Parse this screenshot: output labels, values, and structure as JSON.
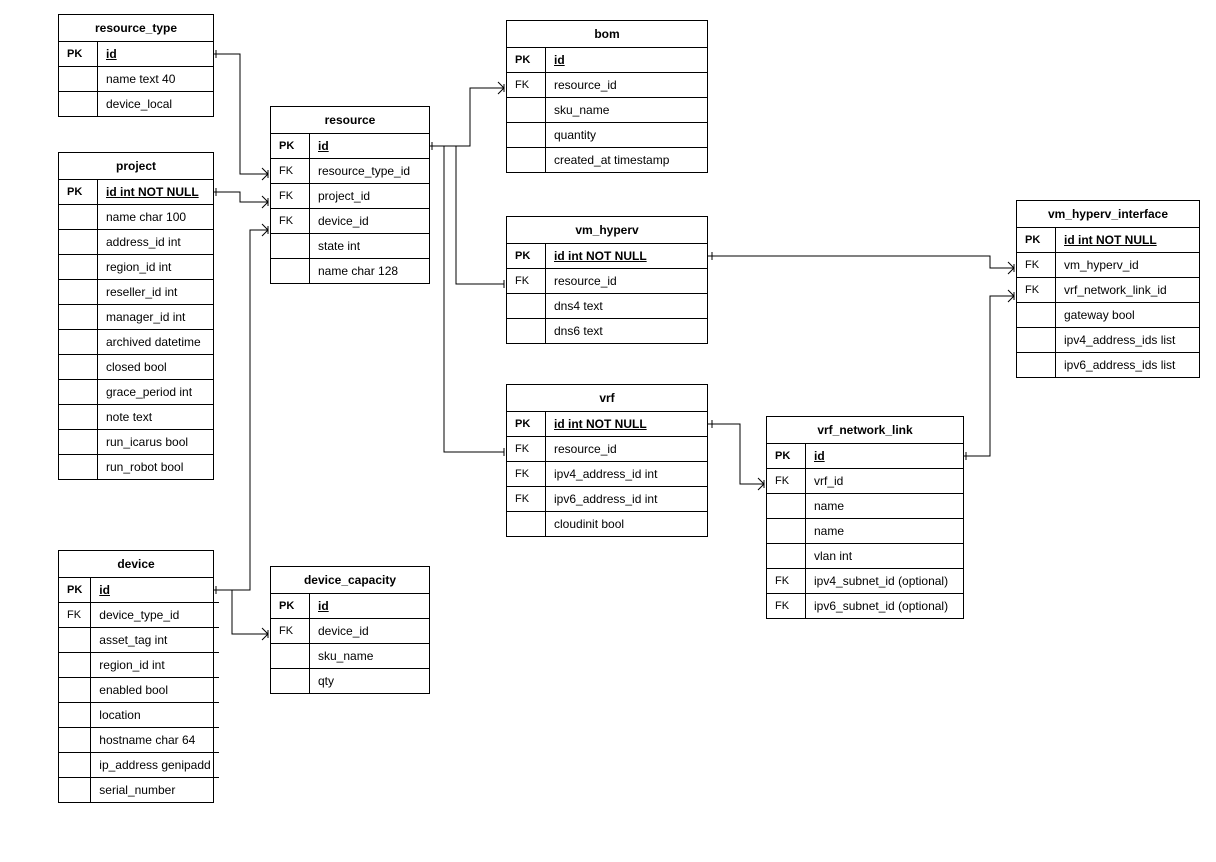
{
  "tables": {
    "resource_type": {
      "title": "resource_type",
      "rows": [
        {
          "key": "PK",
          "field": "id",
          "pk": true
        },
        {
          "key": "",
          "field": "name text 40"
        },
        {
          "key": "",
          "field": "device_local"
        }
      ]
    },
    "project": {
      "title": "project",
      "rows": [
        {
          "key": "PK",
          "field": "id int NOT NULL",
          "pk": true
        },
        {
          "key": "",
          "field": "name char 100"
        },
        {
          "key": "",
          "field": "address_id int"
        },
        {
          "key": "",
          "field": "region_id int"
        },
        {
          "key": "",
          "field": "reseller_id int"
        },
        {
          "key": "",
          "field": "manager_id int"
        },
        {
          "key": "",
          "field": "archived datetime"
        },
        {
          "key": "",
          "field": "closed bool"
        },
        {
          "key": "",
          "field": "grace_period int"
        },
        {
          "key": "",
          "field": "note text"
        },
        {
          "key": "",
          "field": "run_icarus bool"
        },
        {
          "key": "",
          "field": "run_robot bool"
        }
      ]
    },
    "device": {
      "title": "device",
      "rows": [
        {
          "key": "PK",
          "field": "id",
          "pk": true
        },
        {
          "key": "FK",
          "field": "device_type_id",
          "fk": true
        },
        {
          "key": "",
          "field": "asset_tag int"
        },
        {
          "key": "",
          "field": "region_id int"
        },
        {
          "key": "",
          "field": "enabled bool"
        },
        {
          "key": "",
          "field": "location"
        },
        {
          "key": "",
          "field": "hostname char 64"
        },
        {
          "key": "",
          "field": "ip_address genipadd"
        },
        {
          "key": "",
          "field": "serial_number"
        }
      ]
    },
    "resource": {
      "title": "resource",
      "rows": [
        {
          "key": "PK",
          "field": "id",
          "pk": true
        },
        {
          "key": "FK",
          "field": "resource_type_id",
          "fk": true
        },
        {
          "key": "FK",
          "field": "project_id",
          "fk": true
        },
        {
          "key": "FK",
          "field": "device_id",
          "fk": true
        },
        {
          "key": "",
          "field": "state int"
        },
        {
          "key": "",
          "field": "name char 128"
        }
      ]
    },
    "device_capacity": {
      "title": "device_capacity",
      "rows": [
        {
          "key": "PK",
          "field": "id",
          "pk": true
        },
        {
          "key": "FK",
          "field": "device_id",
          "fk": true
        },
        {
          "key": "",
          "field": "sku_name"
        },
        {
          "key": "",
          "field": "qty"
        }
      ]
    },
    "bom": {
      "title": "bom",
      "rows": [
        {
          "key": "PK",
          "field": "id",
          "pk": true
        },
        {
          "key": "FK",
          "field": "resource_id",
          "fk": true
        },
        {
          "key": "",
          "field": "sku_name"
        },
        {
          "key": "",
          "field": "quantity"
        },
        {
          "key": "",
          "field": "created_at timestamp"
        }
      ]
    },
    "vm_hyperv": {
      "title": "vm_hyperv",
      "rows": [
        {
          "key": "PK",
          "field": "id int NOT NULL",
          "pk": true
        },
        {
          "key": "FK",
          "field": "resource_id",
          "fk": true
        },
        {
          "key": "",
          "field": "dns4 text"
        },
        {
          "key": "",
          "field": "dns6 text"
        }
      ]
    },
    "vrf": {
      "title": "vrf",
      "rows": [
        {
          "key": "PK",
          "field": "id int NOT NULL",
          "pk": true
        },
        {
          "key": "FK",
          "field": "resource_id",
          "fk": true
        },
        {
          "key": "FK",
          "field": "ipv4_address_id int",
          "fk": true
        },
        {
          "key": "FK",
          "field": "ipv6_address_id int",
          "fk": true
        },
        {
          "key": "",
          "field": "cloudinit bool"
        }
      ]
    },
    "vrf_network_link": {
      "title": "vrf_network_link",
      "rows": [
        {
          "key": "PK",
          "field": "id",
          "pk": true
        },
        {
          "key": "FK",
          "field": "vrf_id",
          "fk": true
        },
        {
          "key": "",
          "field": "name"
        },
        {
          "key": "",
          "field": "name"
        },
        {
          "key": "",
          "field": "vlan int"
        },
        {
          "key": "FK",
          "field": "ipv4_subnet_id (optional)",
          "fk": true
        },
        {
          "key": "FK",
          "field": "ipv6_subnet_id (optional)",
          "fk": true
        }
      ]
    },
    "vm_hyperv_interface": {
      "title": "vm_hyperv_interface",
      "rows": [
        {
          "key": "PK",
          "field": "id int NOT NULL",
          "pk": true
        },
        {
          "key": "FK",
          "field": "vm_hyperv_id",
          "fk": true
        },
        {
          "key": "FK",
          "field": "vrf_network_link_id",
          "fk": true
        },
        {
          "key": "",
          "field": "gateway bool"
        },
        {
          "key": "",
          "field": "ipv4_address_ids list"
        },
        {
          "key": "",
          "field": "ipv6_address_ids list"
        }
      ]
    }
  }
}
